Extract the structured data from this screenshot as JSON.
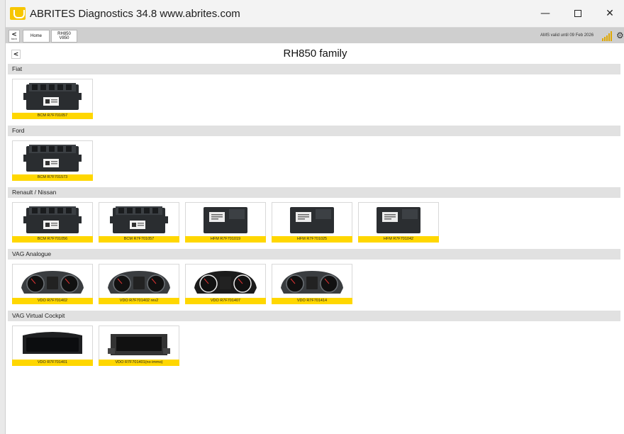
{
  "window": {
    "title": "ABRITES Diagnostics 34.8   www.abrites.com",
    "controls": {
      "minimize": "—",
      "close": "✕"
    }
  },
  "navbar": {
    "back_label": "back",
    "tabs": [
      {
        "label": "Home"
      },
      {
        "label_line1": "RH850",
        "label_line2": "V850"
      }
    ],
    "ams_status": "AMS valid until 09 Feb 2026",
    "signal_color": "#e0a800"
  },
  "page": {
    "title": "RH850 family"
  },
  "sections": [
    {
      "name": "Fiat",
      "items": [
        {
          "label": "BCM R7F701057",
          "image": "bcm-module"
        }
      ]
    },
    {
      "name": "Ford",
      "items": [
        {
          "label": "BCM R7F701573",
          "image": "bcm-module"
        }
      ]
    },
    {
      "name": "Renault / Nissan",
      "items": [
        {
          "label": "BCM R7F701056",
          "image": "bcm-module"
        },
        {
          "label": "BCM R7F701057",
          "image": "bcm-module"
        },
        {
          "label": "HFM R7F701019",
          "image": "hfm-module"
        },
        {
          "label": "HFM R7F701025",
          "image": "hfm-module"
        },
        {
          "label": "HFM R7F701042",
          "image": "hfm-module"
        }
      ]
    },
    {
      "name": "VAG Analogue",
      "items": [
        {
          "label": "VDO R7F701402",
          "image": "instrument-cluster"
        },
        {
          "label": "VDO R7F701402 rev2",
          "image": "instrument-cluster"
        },
        {
          "label": "VDO R7F701407",
          "image": "instrument-cluster-dark"
        },
        {
          "label": "VDO R7F701414",
          "image": "instrument-cluster"
        }
      ]
    },
    {
      "name": "VAG Virtual Cockpit",
      "items": [
        {
          "label": "VDO R7F701401",
          "image": "virtual-cockpit"
        },
        {
          "label": "VDO R7F701401(no immo)",
          "image": "virtual-cockpit-bare"
        }
      ]
    }
  ],
  "colors": {
    "label_bg": "#ffd700",
    "section_bg": "#e1e1e1"
  }
}
